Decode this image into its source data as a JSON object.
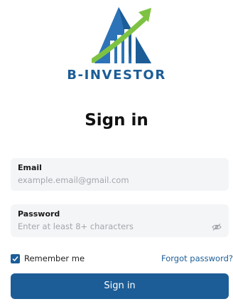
{
  "brand": {
    "name": "B-INVESTOR"
  },
  "page": {
    "title": "Sign in"
  },
  "form": {
    "email": {
      "label": "Email",
      "placeholder": "example.email@gmail.com",
      "value": ""
    },
    "password": {
      "label": "Password",
      "placeholder": "Enter at least 8+ characters",
      "value": ""
    },
    "remember": {
      "label": "Remember me",
      "checked": true
    },
    "forgot_link": "Forgot password?",
    "submit_label": "Sign in"
  },
  "icons": {
    "logo": "b-investor-logo-icon",
    "eye": "eye-slash-icon",
    "check": "check-icon"
  },
  "colors": {
    "primary": "#1c5d97",
    "accent": "#7dc242",
    "field_bg": "#f4f5f7"
  }
}
